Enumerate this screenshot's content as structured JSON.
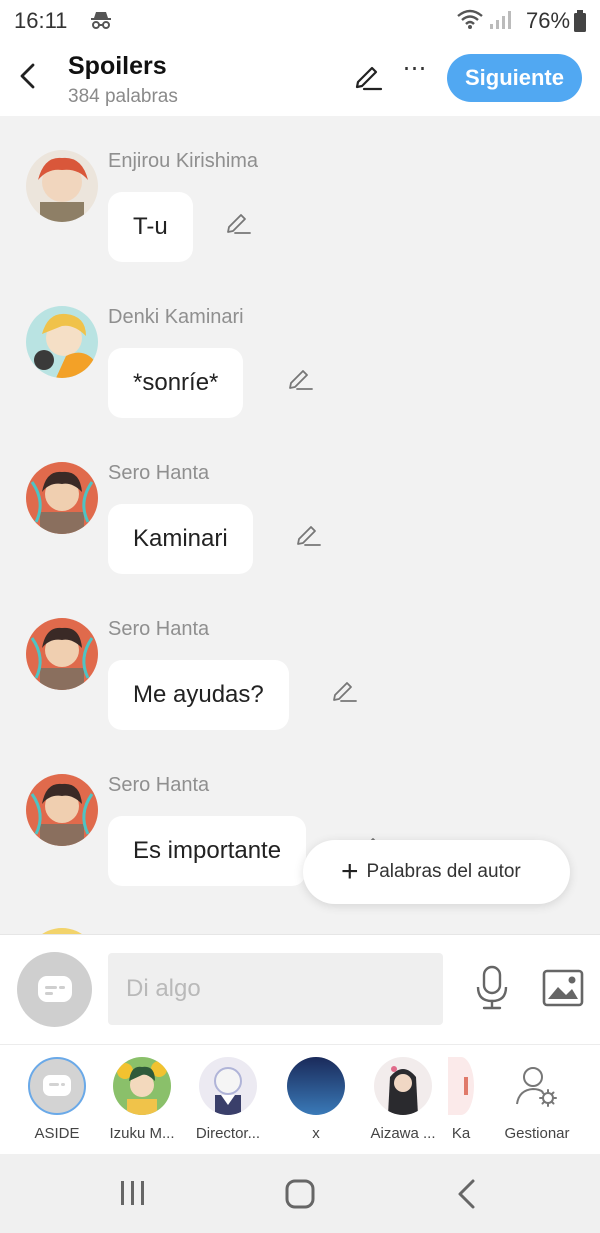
{
  "status": {
    "time": "16:11",
    "battery": "76%",
    "icons": [
      "incognito-icon",
      "wifi-icon",
      "signal-icon",
      "battery-icon"
    ]
  },
  "header": {
    "title": "Spoilers",
    "subtitle": "384 palabras",
    "next_label": "Siguiente",
    "more_label": "⋯"
  },
  "messages": [
    {
      "name": "Enjirou Kirishima",
      "text": "T-u",
      "avatar_colors": [
        "#d9573a",
        "#c9b79a"
      ]
    },
    {
      "name": "Denki Kaminari",
      "text": "*sonríe*",
      "avatar_colors": [
        "#f0c24a",
        "#9fd6d8"
      ]
    },
    {
      "name": "Sero Hanta",
      "text": "Kaminari",
      "avatar_colors": [
        "#e06a4c",
        "#4b3a36"
      ]
    },
    {
      "name": "Sero Hanta",
      "text": "Me ayudas?",
      "avatar_colors": [
        "#e06a4c",
        "#4b3a36"
      ]
    },
    {
      "name": "Sero Hanta",
      "text": "Es importante",
      "avatar_colors": [
        "#e06a4c",
        "#4b3a36"
      ]
    }
  ],
  "fab": {
    "label": "Palabras del autor"
  },
  "input": {
    "placeholder": "Di algo"
  },
  "characters": [
    {
      "label": "ASIDE"
    },
    {
      "label": "Izuku M..."
    },
    {
      "label": "Director..."
    },
    {
      "label": "x"
    },
    {
      "label": "Aizawa ..."
    },
    {
      "label": "Ka"
    },
    {
      "label": "Gestionar"
    }
  ],
  "colors": {
    "accent": "#51a8f2",
    "background": "#f2f2f2"
  }
}
